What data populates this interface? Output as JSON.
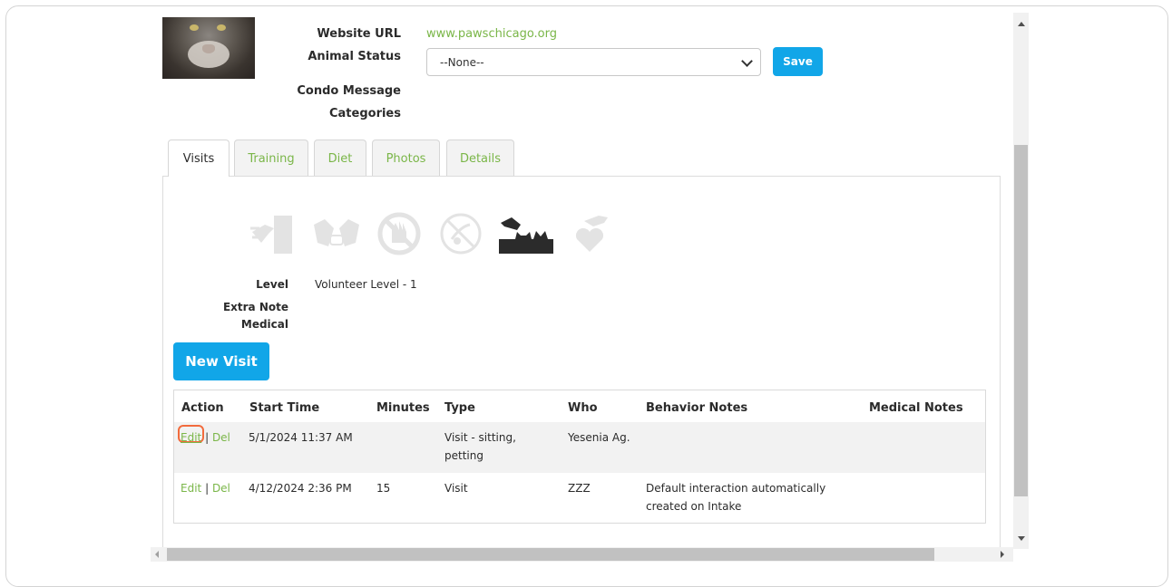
{
  "details": {
    "website_url_label": "Website URL",
    "website_url": "www.pawschicago.org",
    "animal_status_label": "Animal Status",
    "animal_status_value": "--None--",
    "save_label": "Save",
    "condo_message_label": "Condo Message",
    "categories_label": "Categories"
  },
  "tabs": [
    {
      "label": "Visits",
      "active": true
    },
    {
      "label": "Training"
    },
    {
      "label": "Diet"
    },
    {
      "label": "Photos"
    },
    {
      "label": "Details"
    }
  ],
  "behavior_icons": [
    "no-door-dash-icon",
    "no-dogs-icon",
    "no-touch-icon",
    "no-treats-icon",
    "cat-in-litter-box-icon",
    "hand-heart-icon"
  ],
  "visits_info": {
    "level_label": "Level",
    "level_value": "Volunteer Level - 1",
    "extra_note_label": "Extra Note",
    "medical_label": "Medical"
  },
  "new_visit_label": "New Visit",
  "table": {
    "headers": [
      "Action",
      "Start Time",
      "Minutes",
      "Type",
      "Who",
      "Behavior Notes",
      "Medical Notes"
    ],
    "rows": [
      {
        "edit": "Edit",
        "del": "Del",
        "start": "5/1/2024 11:37 AM",
        "minutes": "",
        "type": "Visit - sitting, petting",
        "who": "Yesenia Ag.",
        "behavior": "",
        "medical": ""
      },
      {
        "edit": "Edit",
        "del": "Del",
        "start": "4/12/2024 2:36 PM",
        "minutes": "15",
        "type": "Visit",
        "who": "ZZZ",
        "behavior": "Default interaction automatically created on Intake",
        "medical": ""
      }
    ]
  },
  "colors": {
    "link": "#7ab648",
    "primary_button": "#11a6e8",
    "highlight": "#f26b3d"
  }
}
